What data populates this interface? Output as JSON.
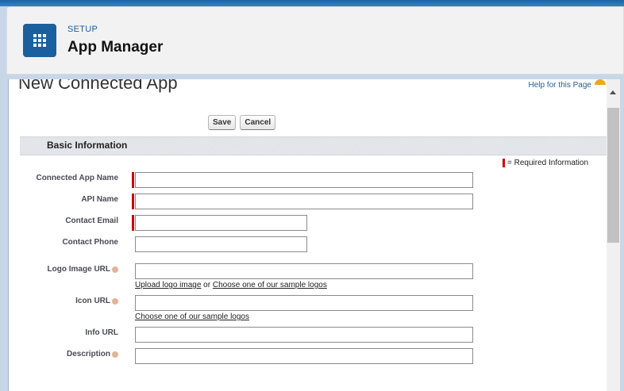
{
  "header": {
    "eyebrow": "SETUP",
    "title": "App Manager",
    "app_icon": "grid-icon"
  },
  "page": {
    "heading": "New Connected App",
    "help_link": "Help for this Page"
  },
  "buttons": {
    "save": "Save",
    "cancel": "Cancel"
  },
  "section": {
    "title": "Basic Information",
    "required_legend": "= Required Information"
  },
  "fields": {
    "connected_app_name": {
      "label": "Connected App Name",
      "value": "",
      "required": true
    },
    "api_name": {
      "label": "API Name",
      "value": "",
      "required": true
    },
    "contact_email": {
      "label": "Contact Email",
      "value": "",
      "required": true
    },
    "contact_phone": {
      "label": "Contact Phone",
      "value": "",
      "required": false
    },
    "logo_image_url": {
      "label": "Logo Image URL",
      "value": "",
      "link_upload": "Upload logo image",
      "link_or": "or",
      "link_samples": "Choose one of our sample logos"
    },
    "icon_url": {
      "label": "Icon URL",
      "value": "",
      "link_samples": "Choose one of our sample logos"
    },
    "info_url": {
      "label": "Info URL",
      "value": ""
    },
    "description": {
      "label": "Description",
      "value": ""
    }
  },
  "colors": {
    "brand_blue": "#1b5f9e",
    "required_red": "#cc0000",
    "help_icon": "#f0a623"
  }
}
